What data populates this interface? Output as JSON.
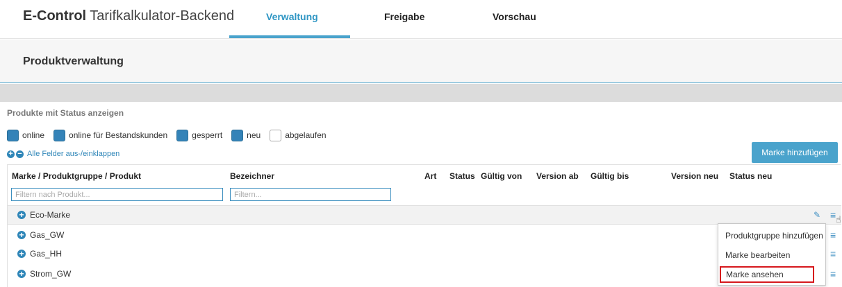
{
  "app": {
    "brand_bold": "E-Control",
    "brand_rest": "Tarifkalkulator-Backend"
  },
  "nav": {
    "tabs": [
      "Verwaltung",
      "Freigabe",
      "Vorschau"
    ],
    "active": "Verwaltung"
  },
  "section": {
    "title": "Produktverwaltung"
  },
  "filters": {
    "label": "Produkte mit Status anzeigen",
    "checkboxes": [
      {
        "label": "online",
        "checked": true
      },
      {
        "label": "online für Bestandskunden",
        "checked": true
      },
      {
        "label": "gesperrt",
        "checked": true
      },
      {
        "label": "neu",
        "checked": true
      },
      {
        "label": "abgelaufen",
        "checked": false
      }
    ],
    "expand_label": "Alle Felder aus-/einklappen"
  },
  "toolbar": {
    "add_brand_label": "Marke hinzufügen"
  },
  "table": {
    "headers": [
      "Marke / Produktgruppe / Produkt",
      "Bezeichner",
      "Art",
      "Status",
      "Gültig von",
      "Version ab",
      "Gültig bis",
      "Version neu",
      "Status neu"
    ],
    "filter_product_placeholder": "Filtern nach Produkt...",
    "filter_identifier_placeholder": "Filtern...",
    "rows": [
      {
        "label": "Eco-Marke"
      },
      {
        "label": "Gas_GW"
      },
      {
        "label": "Gas_HH"
      },
      {
        "label": "Strom_GW"
      }
    ]
  },
  "context_menu": {
    "items": [
      "Produktgruppe hinzufügen",
      "Marke bearbeiten",
      "Marke ansehen"
    ],
    "highlighted": "Marke ansehen"
  },
  "colors": {
    "accent": "#4aa3cc",
    "checkbox": "#3483b8",
    "highlight_border": "#d6171c"
  }
}
